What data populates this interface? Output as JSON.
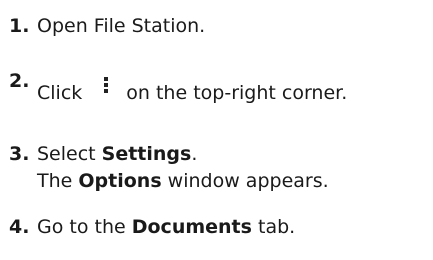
{
  "steps": [
    {
      "number": "1.",
      "text": "Open File Station."
    },
    {
      "number": "2.",
      "before_icon": "Click",
      "icon": "more-vertical-icon",
      "after_icon": "on the top-right corner."
    },
    {
      "number": "3.",
      "line1_prefix": "Select ",
      "line1_bold": "Settings",
      "line1_suffix": ".",
      "line2_prefix": "The ",
      "line2_bold": "Options",
      "line2_suffix": " window appears."
    },
    {
      "number": "4.",
      "prefix": "Go to the ",
      "bold": "Documents",
      "suffix": " tab."
    }
  ]
}
